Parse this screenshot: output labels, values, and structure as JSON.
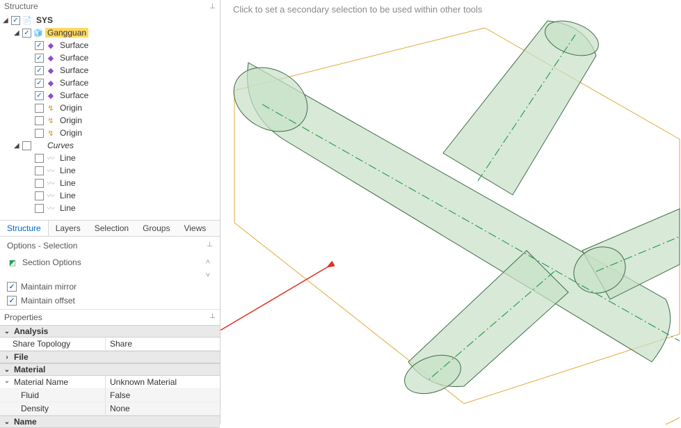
{
  "structure": {
    "title": "Structure",
    "tree": {
      "root": {
        "label": "SYS"
      },
      "component": {
        "label": "Gangguan"
      },
      "surfaces": [
        "Surface",
        "Surface",
        "Surface",
        "Surface",
        "Surface"
      ],
      "origins": [
        "Origin",
        "Origin",
        "Origin"
      ],
      "curves_group": "Curves",
      "lines": [
        "Line",
        "Line",
        "Line",
        "Line",
        "Line"
      ]
    }
  },
  "tabs": [
    "Structure",
    "Layers",
    "Selection",
    "Groups",
    "Views"
  ],
  "options": {
    "title": "Options - Selection",
    "items": {
      "section": "Section Options",
      "mirror": "Maintain mirror",
      "offset": "Maintain offset"
    }
  },
  "properties": {
    "title": "Properties",
    "groups": {
      "analysis": {
        "label": "Analysis",
        "rows": [
          {
            "name": "Share Topology",
            "value": "Share"
          }
        ]
      },
      "file": {
        "label": "File"
      },
      "material": {
        "label": "Material",
        "rows": [
          {
            "name": "Material Name",
            "value": "Unknown Material"
          },
          {
            "name": "Fluid",
            "value": "False",
            "sub": true
          },
          {
            "name": "Density",
            "value": "None",
            "sub": true
          }
        ]
      },
      "name": {
        "label": "Name"
      }
    }
  },
  "viewport": {
    "hint": "Click to set a secondary selection to be used within other tools"
  }
}
